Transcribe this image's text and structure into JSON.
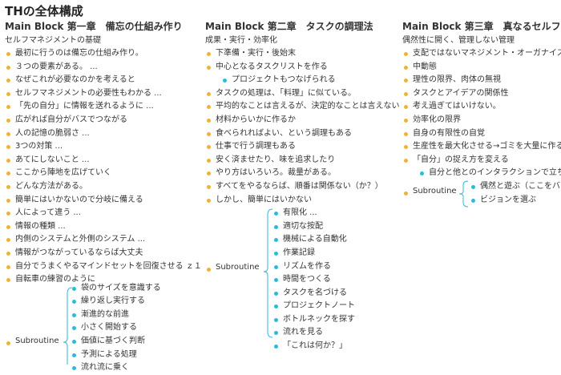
{
  "title": "THの全体構成",
  "columns": [
    {
      "block": "Main Block 第一章　備忘の仕組み作り",
      "subtitle": "セルフマネジメントの基礎",
      "items": [
        "最初に行うのは備忘の仕組み作り。",
        "３つの要素がある。 ...",
        "なぜこれが必要なのかを考えると",
        "セルフマネジメントの必要性もわかる ...",
        "「先の自分」に情報を送れるように ...",
        "広がれば自分がバスでつながる",
        "人の記憶の脆弱さ ...",
        "3つの対策 ...",
        "あてにしないこと ...",
        "ここから陣地を広げていく",
        "どんな方法がある。",
        "簡単にはいかないので分岐に備える",
        "人によって違う ...",
        "情報の種類 ...",
        "内側のシステムと外側のシステム ...",
        "情報がつながっているならば大丈夫",
        "自分でうまくやるマインドセットを回復させる ｚ１",
        "自転車の練習のように"
      ],
      "subroutine_label": "Subroutine",
      "subroutine_items": [
        "袋のサイズを意識する",
        "繰り返し実行する",
        "漸進的な前進",
        "小さく開始する",
        "価値に基づく判断",
        "予測による処理",
        "流れ流に乗く"
      ]
    },
    {
      "block": "Main Block 第二章　タスクの調理法",
      "subtitle": "成果・実行・効率化",
      "items": [
        "下準備・実行・後始末",
        "中心となるタスクリストを作る"
      ],
      "nested_items": [
        "プロジェクトもつなげられる"
      ],
      "items_after": [
        "タスクの処理は、「料理」に似ている。",
        "平均的なことは言えるが、決定的なことは言えない",
        "材料からいかに作るか",
        "食べられればよい、という調理もある",
        "仕事で行う調理もある",
        "安く済ませたり、味を追求したり",
        "やり方はいろいろ。裁量がある。",
        "すべてをやるならば、順番は関係ない（か？）",
        "しかし、簡単にはいかない"
      ],
      "subroutine_label": "Subroutine",
      "subroutine_items": [
        "有限化 ...",
        "適切な按配",
        "機械による自動化",
        "作業記録",
        "リズムを作る",
        "時間をつくる",
        "タスクを名づける",
        "プロジェクトノート",
        "ボトルネックを探す",
        "流れを見る",
        "「これは何か？」"
      ]
    },
    {
      "block": "Main Block 第三章　真なるセルフマネジメント",
      "subtitle": "偶然性に開く、管理しない管理",
      "items": [
        "支配ではないマネジメント・オーガナイズ",
        "中動態",
        "理性の限界、肉体の無視",
        "タスクとアイデアの関係性",
        "考え過ぎてはいけない。",
        "効率化の限界",
        "自身の有限性の自覚",
        "生産性を最大化させる→ゴミを大量に作る",
        "「自分」の捉え方を変える"
      ],
      "nested_items": [
        "自分と他とのインタラクションで立ち上がる"
      ],
      "subroutine_label": "Subroutine",
      "subroutine_items": [
        "偶然と遊ぶ（ここをバターン化する）",
        "ビジョンを選ぶ"
      ]
    }
  ],
  "colors": {
    "orange_bullet": "#f0b13c",
    "blue_bullet": "#30b8d8",
    "brace": "#30b8d8"
  }
}
